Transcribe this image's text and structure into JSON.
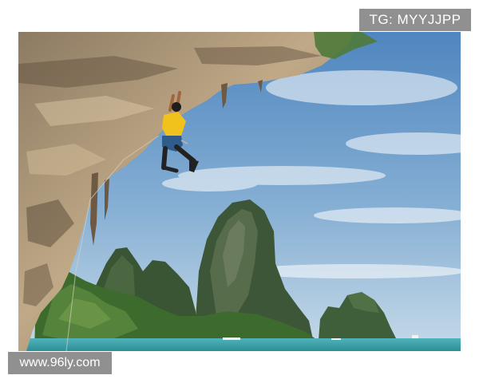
{
  "watermarks": {
    "top_right": "TG: MYYJJPP",
    "bottom_left": "www.96ly.com"
  },
  "colors": {
    "sky_top": "#4f86bf",
    "sky_bottom": "#b7d0e3",
    "sea": "#3ea2ab",
    "rock": "#b39c7c",
    "vegetation": "#3f6a32",
    "shirt": "#f1c21b"
  }
}
